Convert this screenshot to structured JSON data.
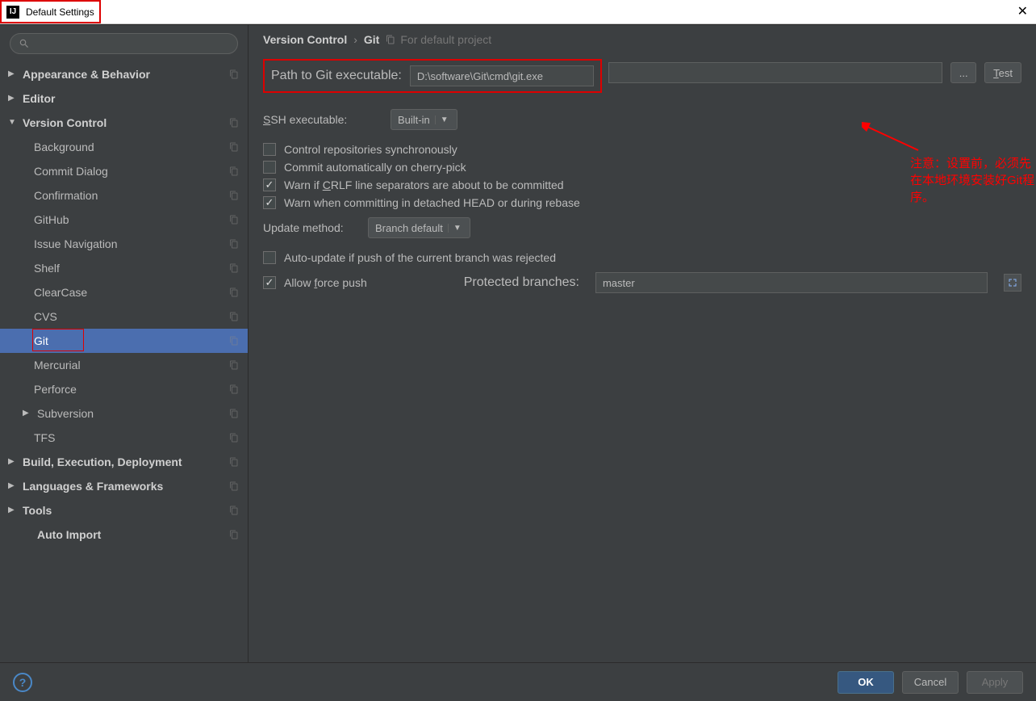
{
  "title": "Default Settings",
  "search_placeholder": "",
  "breadcrumb": {
    "a": "Version Control",
    "b": "Git",
    "hint": "For default project"
  },
  "sidebar": {
    "items": [
      {
        "label": "Appearance & Behavior",
        "bold": true,
        "arrow": "closed",
        "lvl": 0,
        "copy": true
      },
      {
        "label": "Editor",
        "bold": true,
        "arrow": "closed",
        "lvl": 0,
        "copy": false
      },
      {
        "label": "Version Control",
        "bold": true,
        "arrow": "open",
        "lvl": 0,
        "copy": true
      },
      {
        "label": "Background",
        "lvl": 1,
        "copy": true
      },
      {
        "label": "Commit Dialog",
        "lvl": 1,
        "copy": true
      },
      {
        "label": "Confirmation",
        "lvl": 1,
        "copy": true
      },
      {
        "label": "GitHub",
        "lvl": 1,
        "copy": true
      },
      {
        "label": "Issue Navigation",
        "lvl": 1,
        "copy": true
      },
      {
        "label": "Shelf",
        "lvl": 1,
        "copy": true
      },
      {
        "label": "ClearCase",
        "lvl": 1,
        "copy": true
      },
      {
        "label": "CVS",
        "lvl": 1,
        "copy": true
      },
      {
        "label": "Git",
        "lvl": 1,
        "copy": true,
        "selected": true
      },
      {
        "label": "Mercurial",
        "lvl": 1,
        "copy": true
      },
      {
        "label": "Perforce",
        "lvl": 1,
        "copy": true
      },
      {
        "label": "Subversion",
        "lvl": 1,
        "copy": true,
        "arrow": "closed",
        "arrowrow": true
      },
      {
        "label": "TFS",
        "lvl": 1,
        "copy": true
      },
      {
        "label": "Build, Execution, Deployment",
        "bold": true,
        "arrow": "closed",
        "lvl": 0,
        "copy": true
      },
      {
        "label": "Languages & Frameworks",
        "bold": true,
        "arrow": "closed",
        "lvl": 0,
        "copy": true
      },
      {
        "label": "Tools",
        "bold": true,
        "arrow": "closed",
        "lvl": 0,
        "copy": true
      },
      {
        "label": "Auto Import",
        "bold": true,
        "lvl": 0,
        "indent": true,
        "copy": true
      }
    ]
  },
  "form": {
    "path_label": "Path to Git executable:",
    "path_value": "D:\\software\\Git\\cmd\\git.exe",
    "browse_label": "...",
    "test_label": "Test",
    "ssh_label": "SSH executable:",
    "ssh_value": "Built-in",
    "chk1": "Control repositories synchronously",
    "chk2": "Commit automatically on cherry-pick",
    "chk3": "Warn if CRLF line separators are about to be committed",
    "chk4": "Warn when committing in detached HEAD or during rebase",
    "update_label": "Update method:",
    "update_value": "Branch default",
    "chk5": "Auto-update if push of the current branch was rejected",
    "chk6": "Allow force push",
    "protected_label": "Protected branches:",
    "protected_value": "master"
  },
  "annotation": "注意：设置前，必须先在本地环境安装好Git程序。",
  "footer": {
    "ok": "OK",
    "cancel": "Cancel",
    "apply": "Apply"
  }
}
